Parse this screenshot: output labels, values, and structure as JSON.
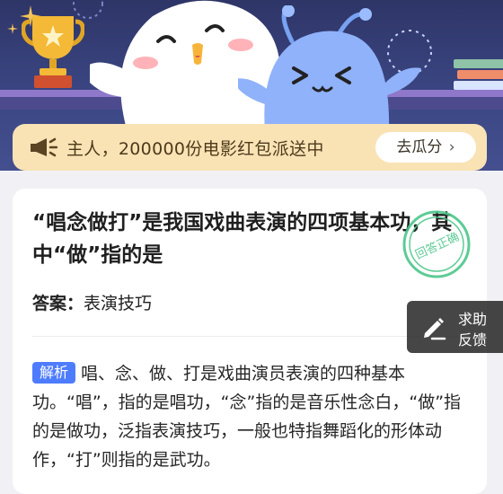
{
  "banner": {
    "text": "主人，200000份电影红包派送中",
    "button_label": "去瓜分",
    "button_chevron": "›",
    "icon": "megaphone-icon"
  },
  "question": {
    "text": "“唱念做打”是我国戏曲表演的四项基本功，其中“做”指的是",
    "stamp_text": "回答正确"
  },
  "answer": {
    "label": "答案：",
    "value": "表演技巧"
  },
  "explanation": {
    "tag": "解析",
    "text": "唱、念、做、打是戏曲演员表演的四种基本功。“唱”，指的是唱功，“念”指的是音乐性念白，“做”指的是做功，泛指表演技巧，一般也特指舞蹈化的形体动作，“打”则指的是武功。"
  },
  "help_button": {
    "line1": "求助",
    "line2": "反馈",
    "icon": "pencil-edit-icon"
  },
  "colors": {
    "hero_bg": "#3b4683",
    "banner_bg": "#f9e3b5",
    "tag_blue": "#4d7cff",
    "stamp_green": "#4cc68a"
  }
}
